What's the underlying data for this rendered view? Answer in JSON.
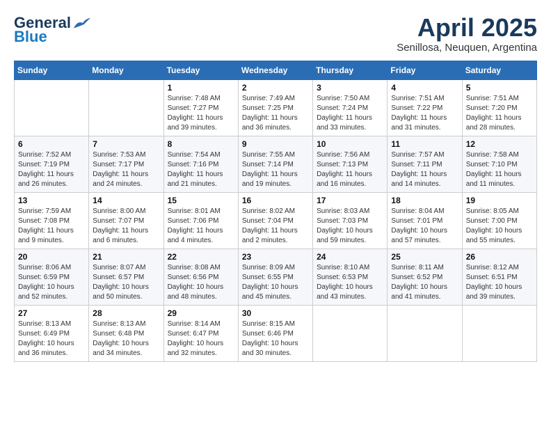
{
  "logo": {
    "general": "General",
    "blue": "Blue"
  },
  "header": {
    "month": "April 2025",
    "location": "Senillosa, Neuquen, Argentina"
  },
  "weekdays": [
    "Sunday",
    "Monday",
    "Tuesday",
    "Wednesday",
    "Thursday",
    "Friday",
    "Saturday"
  ],
  "weeks": [
    [
      {
        "day": "",
        "info": ""
      },
      {
        "day": "",
        "info": ""
      },
      {
        "day": "1",
        "info": "Sunrise: 7:48 AM\nSunset: 7:27 PM\nDaylight: 11 hours and 39 minutes."
      },
      {
        "day": "2",
        "info": "Sunrise: 7:49 AM\nSunset: 7:25 PM\nDaylight: 11 hours and 36 minutes."
      },
      {
        "day": "3",
        "info": "Sunrise: 7:50 AM\nSunset: 7:24 PM\nDaylight: 11 hours and 33 minutes."
      },
      {
        "day": "4",
        "info": "Sunrise: 7:51 AM\nSunset: 7:22 PM\nDaylight: 11 hours and 31 minutes."
      },
      {
        "day": "5",
        "info": "Sunrise: 7:51 AM\nSunset: 7:20 PM\nDaylight: 11 hours and 28 minutes."
      }
    ],
    [
      {
        "day": "6",
        "info": "Sunrise: 7:52 AM\nSunset: 7:19 PM\nDaylight: 11 hours and 26 minutes."
      },
      {
        "day": "7",
        "info": "Sunrise: 7:53 AM\nSunset: 7:17 PM\nDaylight: 11 hours and 24 minutes."
      },
      {
        "day": "8",
        "info": "Sunrise: 7:54 AM\nSunset: 7:16 PM\nDaylight: 11 hours and 21 minutes."
      },
      {
        "day": "9",
        "info": "Sunrise: 7:55 AM\nSunset: 7:14 PM\nDaylight: 11 hours and 19 minutes."
      },
      {
        "day": "10",
        "info": "Sunrise: 7:56 AM\nSunset: 7:13 PM\nDaylight: 11 hours and 16 minutes."
      },
      {
        "day": "11",
        "info": "Sunrise: 7:57 AM\nSunset: 7:11 PM\nDaylight: 11 hours and 14 minutes."
      },
      {
        "day": "12",
        "info": "Sunrise: 7:58 AM\nSunset: 7:10 PM\nDaylight: 11 hours and 11 minutes."
      }
    ],
    [
      {
        "day": "13",
        "info": "Sunrise: 7:59 AM\nSunset: 7:08 PM\nDaylight: 11 hours and 9 minutes."
      },
      {
        "day": "14",
        "info": "Sunrise: 8:00 AM\nSunset: 7:07 PM\nDaylight: 11 hours and 6 minutes."
      },
      {
        "day": "15",
        "info": "Sunrise: 8:01 AM\nSunset: 7:06 PM\nDaylight: 11 hours and 4 minutes."
      },
      {
        "day": "16",
        "info": "Sunrise: 8:02 AM\nSunset: 7:04 PM\nDaylight: 11 hours and 2 minutes."
      },
      {
        "day": "17",
        "info": "Sunrise: 8:03 AM\nSunset: 7:03 PM\nDaylight: 10 hours and 59 minutes."
      },
      {
        "day": "18",
        "info": "Sunrise: 8:04 AM\nSunset: 7:01 PM\nDaylight: 10 hours and 57 minutes."
      },
      {
        "day": "19",
        "info": "Sunrise: 8:05 AM\nSunset: 7:00 PM\nDaylight: 10 hours and 55 minutes."
      }
    ],
    [
      {
        "day": "20",
        "info": "Sunrise: 8:06 AM\nSunset: 6:59 PM\nDaylight: 10 hours and 52 minutes."
      },
      {
        "day": "21",
        "info": "Sunrise: 8:07 AM\nSunset: 6:57 PM\nDaylight: 10 hours and 50 minutes."
      },
      {
        "day": "22",
        "info": "Sunrise: 8:08 AM\nSunset: 6:56 PM\nDaylight: 10 hours and 48 minutes."
      },
      {
        "day": "23",
        "info": "Sunrise: 8:09 AM\nSunset: 6:55 PM\nDaylight: 10 hours and 45 minutes."
      },
      {
        "day": "24",
        "info": "Sunrise: 8:10 AM\nSunset: 6:53 PM\nDaylight: 10 hours and 43 minutes."
      },
      {
        "day": "25",
        "info": "Sunrise: 8:11 AM\nSunset: 6:52 PM\nDaylight: 10 hours and 41 minutes."
      },
      {
        "day": "26",
        "info": "Sunrise: 8:12 AM\nSunset: 6:51 PM\nDaylight: 10 hours and 39 minutes."
      }
    ],
    [
      {
        "day": "27",
        "info": "Sunrise: 8:13 AM\nSunset: 6:49 PM\nDaylight: 10 hours and 36 minutes."
      },
      {
        "day": "28",
        "info": "Sunrise: 8:13 AM\nSunset: 6:48 PM\nDaylight: 10 hours and 34 minutes."
      },
      {
        "day": "29",
        "info": "Sunrise: 8:14 AM\nSunset: 6:47 PM\nDaylight: 10 hours and 32 minutes."
      },
      {
        "day": "30",
        "info": "Sunrise: 8:15 AM\nSunset: 6:46 PM\nDaylight: 10 hours and 30 minutes."
      },
      {
        "day": "",
        "info": ""
      },
      {
        "day": "",
        "info": ""
      },
      {
        "day": "",
        "info": ""
      }
    ]
  ]
}
